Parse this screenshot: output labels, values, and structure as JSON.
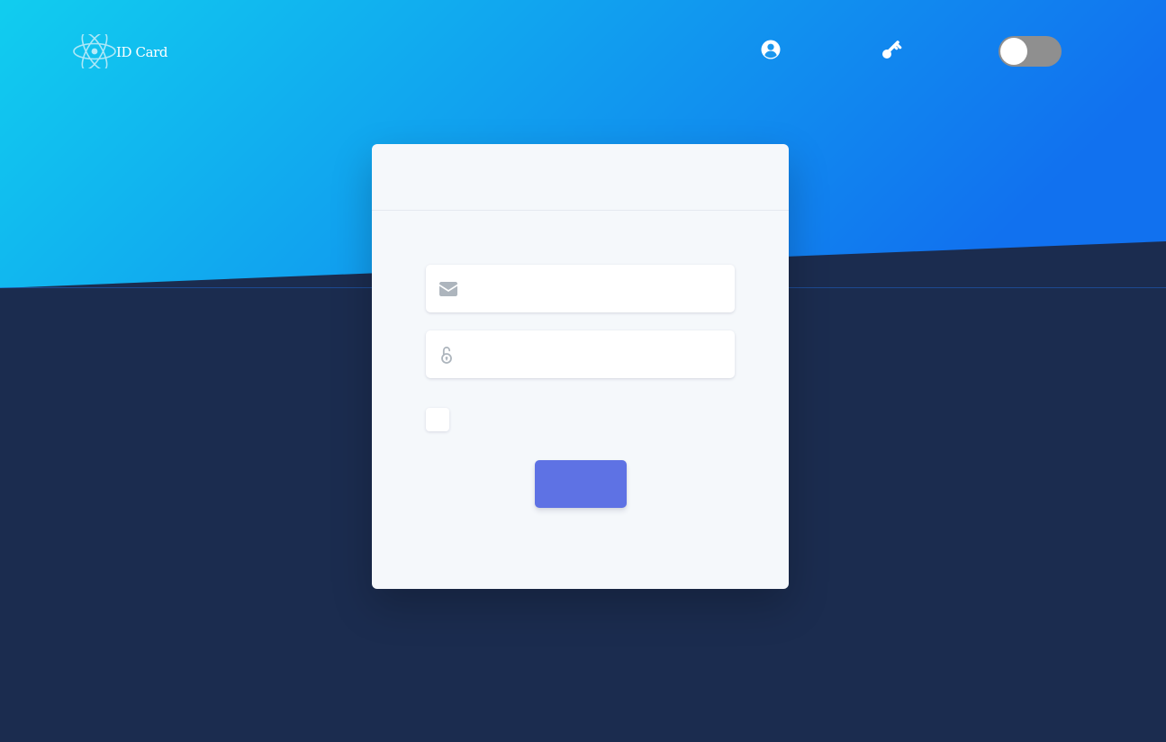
{
  "navbar": {
    "brand_text": "ID Card",
    "profile_icon": "user-circle-icon",
    "key_icon": "key-icon",
    "theme_toggle_state": "off"
  },
  "login_form": {
    "email_icon": "envelope-icon",
    "email_value": "",
    "password_icon": "unlock-icon",
    "password_value": "",
    "remember_checked": false,
    "submit_label": ""
  },
  "colors": {
    "hero_gradient_start": "#11cdef",
    "hero_gradient_end": "#1171ef",
    "page_background": "#1b2c4f",
    "card_background": "#f5f8fb",
    "primary_button": "#5e72e4",
    "toggle_track": "#8f8f8f",
    "icon_muted": "#adb5bd"
  }
}
